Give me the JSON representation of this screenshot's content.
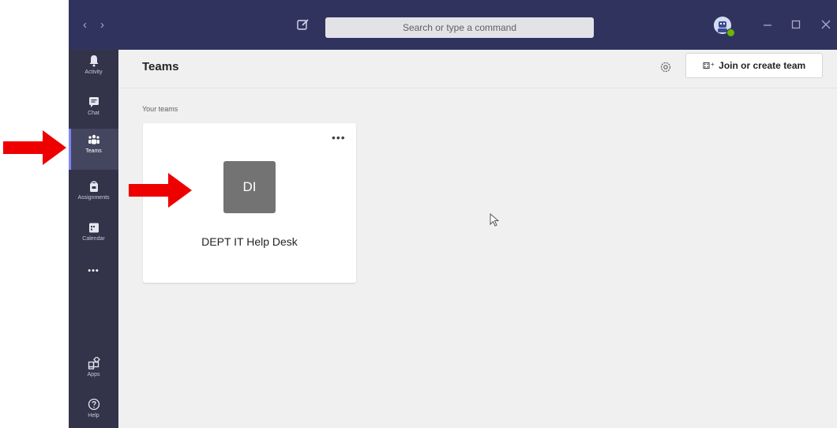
{
  "titlebar": {
    "back_icon": "chevron-left-icon",
    "forward_icon": "chevron-right-icon",
    "back_glyph": "‹",
    "forward_glyph": "›",
    "compose_icon": "compose-icon",
    "search_placeholder": "Search or type a command",
    "avatar_icon": "bot-avatar-icon"
  },
  "rail": {
    "items": [
      {
        "label": "Activity",
        "icon": "bell-icon"
      },
      {
        "label": "Chat",
        "icon": "chat-icon"
      },
      {
        "label": "Teams",
        "icon": "teams-icon",
        "active": true
      },
      {
        "label": "Assignments",
        "icon": "assignments-icon"
      },
      {
        "label": "Calendar",
        "icon": "calendar-icon"
      }
    ],
    "more": "•••",
    "bottom": [
      {
        "label": "Apps",
        "icon": "apps-icon"
      },
      {
        "label": "Help",
        "icon": "help-icon"
      }
    ]
  },
  "main": {
    "title": "Teams",
    "join_label": "Join or create team",
    "section_label": "Your teams",
    "teams": [
      {
        "initials": "DI",
        "name": "DEPT IT Help Desk",
        "more": "•••"
      }
    ]
  },
  "colors": {
    "titlebar": "#31335f",
    "rail": "#33344a",
    "accent": "#7f85f5",
    "background": "#f0f0f0",
    "team_tile": "#737373",
    "annotation_arrow": "#ee0000"
  }
}
